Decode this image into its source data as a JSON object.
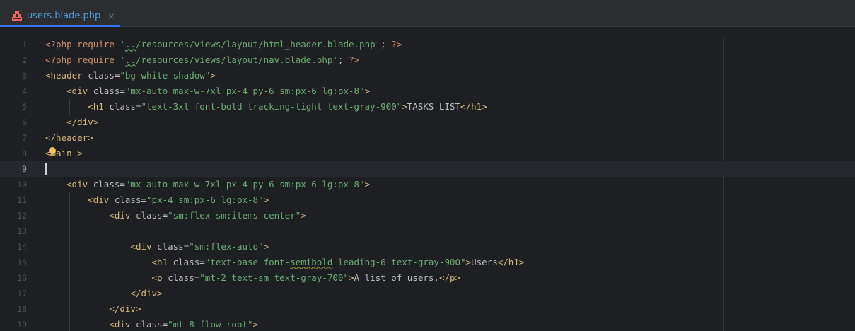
{
  "tab": {
    "filename": "users.blade.php",
    "close_glyph": "×",
    "icon": "blade-file-icon"
  },
  "colors": {
    "background": "#1e1f22",
    "tabbar": "#2b2d30",
    "accent": "#3574f0",
    "tag": "#d5b778",
    "string": "#6aab73",
    "keyword": "#cf8e6d"
  },
  "lines": [
    {
      "number": "1",
      "php_open": "<?php",
      "keyword": " require ",
      "q1": "'",
      "typo": "..",
      "path": "/resources/views/layout/html_header.blade.php",
      "q2": "'",
      "semi": "; ",
      "php_close": "?>"
    },
    {
      "number": "2",
      "php_open": "<?php",
      "keyword": " require ",
      "q1": "'",
      "typo": "..",
      "path": "/resources/views/layout/nav.blade.php",
      "q2": "'",
      "semi": "; ",
      "php_close": "?>"
    },
    {
      "number": "3",
      "open": "<header",
      "attr": " class",
      "eq": "=",
      "value": "\"bg-white shadow\"",
      "close": ">"
    },
    {
      "number": "4",
      "indent": "    ",
      "open": "<div",
      "attr": " class",
      "eq": "=",
      "value": "\"mx-auto max-w-7xl px-4 py-6 sm:px-6 lg:px-8\"",
      "close": ">"
    },
    {
      "number": "5",
      "indent": "        ",
      "open": "<h1",
      "attr": " class",
      "eq": "=",
      "value": "\"text-3xl font-bold tracking-tight text-gray-900\"",
      "close": ">",
      "text": "TASKS LIST",
      "end": "</h1>"
    },
    {
      "number": "6",
      "indent": "    ",
      "end": "</div>"
    },
    {
      "number": "7",
      "end": "</header>"
    },
    {
      "number": "8",
      "open": "<main",
      "rest": " >"
    },
    {
      "number": "9"
    },
    {
      "number": "10",
      "indent": "    ",
      "open": "<div",
      "attr": " class",
      "eq": "=",
      "value": "\"mx-auto max-w-7xl px-4 py-6 sm:px-6 lg:px-8\"",
      "close": ">"
    },
    {
      "number": "11",
      "indent": "        ",
      "open": "<div",
      "attr": " class",
      "eq": "=",
      "value": "\"px-4 sm:px-6 lg:px-8\"",
      "close": ">"
    },
    {
      "number": "12",
      "indent": "            ",
      "open": "<div",
      "attr": " class",
      "eq": "=",
      "value": "\"sm:flex sm:items-center\"",
      "close": ">"
    },
    {
      "number": "13"
    },
    {
      "number": "14",
      "indent": "                ",
      "open": "<div",
      "attr": " class",
      "eq": "=",
      "value": "\"sm:flex-auto\"",
      "close": ">"
    },
    {
      "number": "15",
      "indent": "                    ",
      "open": "<h1",
      "attr": " class",
      "eq": "=",
      "v1": "\"text-base font-",
      "vtypo": "semibold",
      "v2": " leading-6 text-gray-900\"",
      "close": ">",
      "text": "Users",
      "end": "</h1>"
    },
    {
      "number": "16",
      "indent": "                    ",
      "open": "<p",
      "attr": " class",
      "eq": "=",
      "value": "\"mt-2 text-sm text-gray-700\"",
      "close": ">",
      "text": "A list of users.",
      "end": "</p>"
    },
    {
      "number": "17",
      "indent": "                ",
      "end": "</div>"
    },
    {
      "number": "18",
      "indent": "            ",
      "end": "</div>"
    },
    {
      "number": "19",
      "indent": "            ",
      "open": "<div",
      "attr": " class",
      "eq": "=",
      "value": "\"mt-8 flow-root\"",
      "close": ">"
    }
  ]
}
